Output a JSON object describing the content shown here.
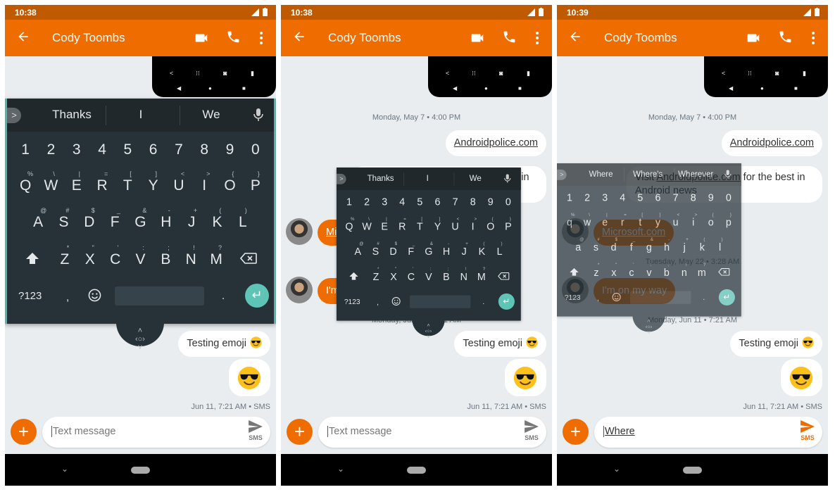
{
  "conversation": {
    "date_1": "Monday, May 7 • 4:00 PM",
    "msg_link": "Androidpolice.com",
    "msg_visit_prefix": "Visit ",
    "msg_visit_link": "Androidpolice.com",
    "msg_visit_suffix": " for the best in Android news",
    "msg_microsoft": "Microsoft.com",
    "date_2": "Tuesday, May 22 • 3:28 AM",
    "msg_onmyway": "I'm on my way",
    "date_3": "Monday, Jun 11 • 7:21 AM",
    "msg_testing": "Testing emoji",
    "emoji": "smiling-face-with-sunglasses",
    "timestamp": "Jun 11, 7:21 AM • SMS"
  },
  "colors": {
    "accent": "#ef6c00",
    "status_bar": "#c05a00",
    "keyboard": "#263238",
    "enter": "#5ec4b6"
  },
  "keyboard_keys": {
    "numbers": [
      "1",
      "2",
      "3",
      "4",
      "5",
      "6",
      "7",
      "8",
      "9",
      "0"
    ],
    "row1": [
      "Q",
      "W",
      "E",
      "R",
      "T",
      "Y",
      "U",
      "I",
      "O",
      "P"
    ],
    "row1_hints": [
      "%",
      "\\",
      "|",
      "=",
      "[",
      "]",
      "<",
      ">",
      "{",
      "}"
    ],
    "row2": [
      "A",
      "S",
      "D",
      "F",
      "G",
      "H",
      "J",
      "K",
      "L"
    ],
    "row2_hints": [
      "@",
      "#",
      "$",
      "_",
      "&",
      "-",
      "+",
      "(",
      ")"
    ],
    "row3": [
      "Z",
      "X",
      "C",
      "V",
      "B",
      "N",
      "M"
    ],
    "row3_hints": [
      "*",
      "\"",
      "'",
      ":",
      ";",
      "!",
      "?"
    ],
    "symbols_label": "?123",
    "comma": ",",
    "period": "."
  },
  "panels": [
    {
      "time": "10:38",
      "title": "Cody Toombs",
      "suggestions": [
        "Thanks",
        "I",
        "We"
      ],
      "lowercase": false,
      "composer": {
        "placeholder": "Text message",
        "value": ""
      },
      "send_label": "SMS",
      "keyboard_mode": "docked"
    },
    {
      "time": "10:38",
      "title": "Cody Toombs",
      "suggestions": [
        "Thanks",
        "I",
        "We"
      ],
      "lowercase": false,
      "composer": {
        "placeholder": "Text message",
        "value": ""
      },
      "send_label": "SMS",
      "keyboard_mode": "floating"
    },
    {
      "time": "10:39",
      "title": "Cody Toombs",
      "suggestions": [
        "Where",
        "Where's",
        "Wherever"
      ],
      "lowercase": true,
      "composer": {
        "placeholder": "Text message",
        "value": "Where"
      },
      "send_label": "SMS",
      "keyboard_mode": "floating-transparent"
    }
  ]
}
